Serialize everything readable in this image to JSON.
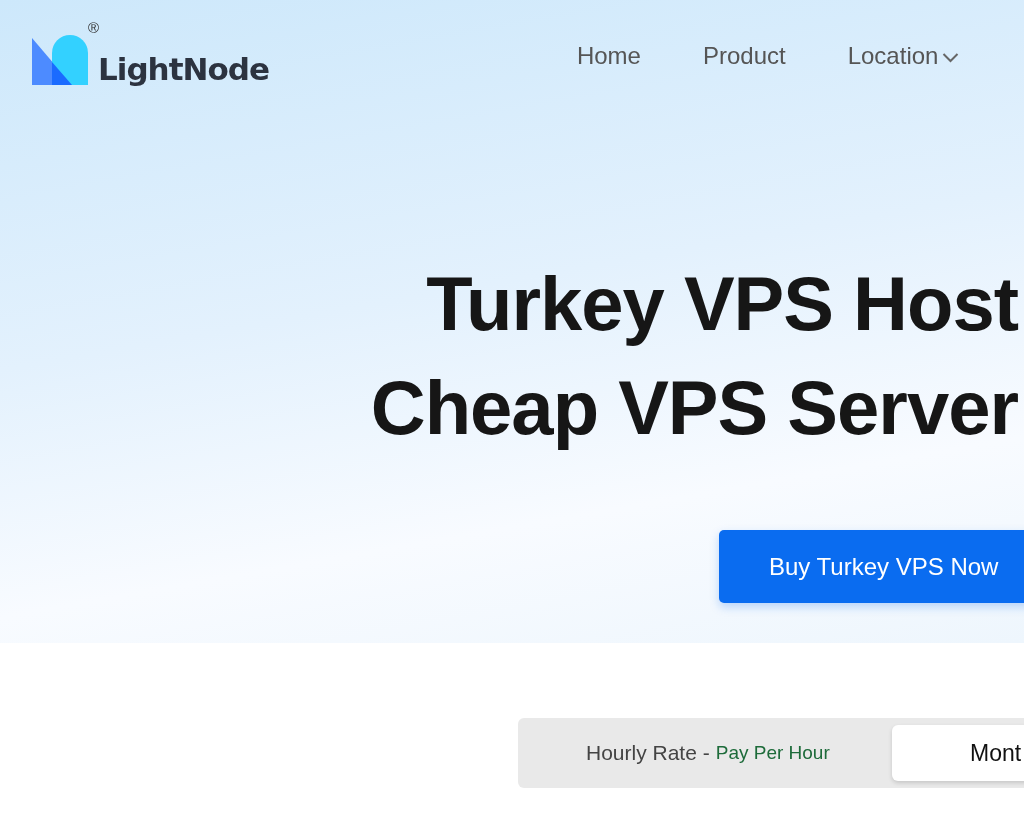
{
  "logo": {
    "name": "LightNode",
    "mark": "®"
  },
  "nav": [
    {
      "label": "Home",
      "kind": "link"
    },
    {
      "label": "Product",
      "kind": "link"
    },
    {
      "label": "Location",
      "kind": "dropdown"
    }
  ],
  "hero": {
    "title_lines": [
      "Turkey VPS Host",
      "Cheap VPS Server"
    ],
    "button": "Buy Turkey VPS Now"
  },
  "billing_tabs": [
    {
      "label": "Hourly Rate -",
      "note": "Pay Per Hour",
      "selected": false
    },
    {
      "label": "Mont",
      "selected": true
    }
  ]
}
